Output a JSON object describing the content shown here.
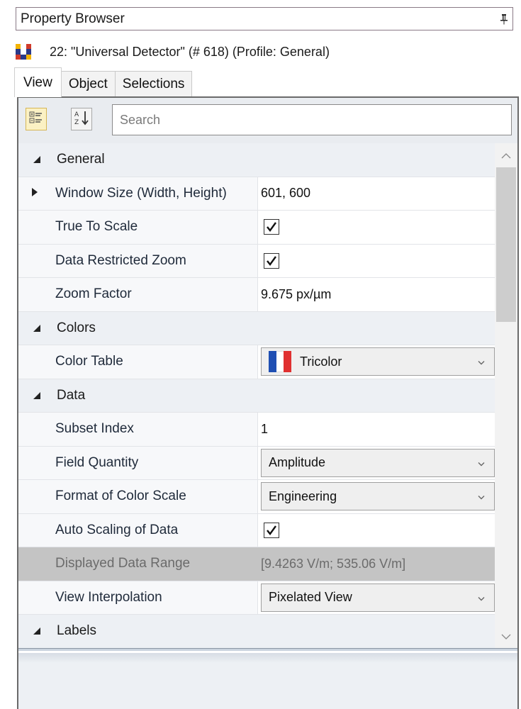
{
  "window": {
    "title": "Property Browser"
  },
  "object": {
    "label": "22: \"Universal Detector\" (# 618) (Profile: General)"
  },
  "tabs": [
    {
      "label": "View",
      "active": true
    },
    {
      "label": "Object",
      "active": false
    },
    {
      "label": "Selections",
      "active": false
    }
  ],
  "toolbar": {
    "search_placeholder": "Search",
    "categorized_icon": "categorized-view-icon",
    "alpha_icon": "sort-alphabetical-icon"
  },
  "categories": {
    "general": "General",
    "colors": "Colors",
    "data": "Data",
    "labels": "Labels"
  },
  "properties": {
    "window_size": {
      "name": "Window Size (Width, Height)",
      "value": "601, 600"
    },
    "true_to_scale": {
      "name": "True To Scale",
      "checked": true
    },
    "data_restricted_zoom": {
      "name": "Data Restricted Zoom",
      "checked": true
    },
    "zoom_factor": {
      "name": "Zoom Factor",
      "value": "9.675 px/µm"
    },
    "color_table": {
      "name": "Color Table",
      "value": "Tricolor"
    },
    "subset_index": {
      "name": "Subset Index",
      "value": "1"
    },
    "field_quantity": {
      "name": "Field Quantity",
      "value": "Amplitude"
    },
    "format_color_scale": {
      "name": "Format of Color Scale",
      "value": "Engineering"
    },
    "auto_scaling": {
      "name": "Auto Scaling of Data",
      "checked": true
    },
    "displayed_range": {
      "name": "Displayed Data Range",
      "value": "[9.4263 V/m; 535.06 V/m]"
    },
    "view_interpolation": {
      "name": "View Interpolation",
      "value": "Pixelated View"
    }
  },
  "colors": {
    "tricolor_left": "#1f4fb3",
    "tricolor_mid": "#ffffff",
    "tricolor_right": "#e03030",
    "toggle_active": "#fbf1c4"
  }
}
